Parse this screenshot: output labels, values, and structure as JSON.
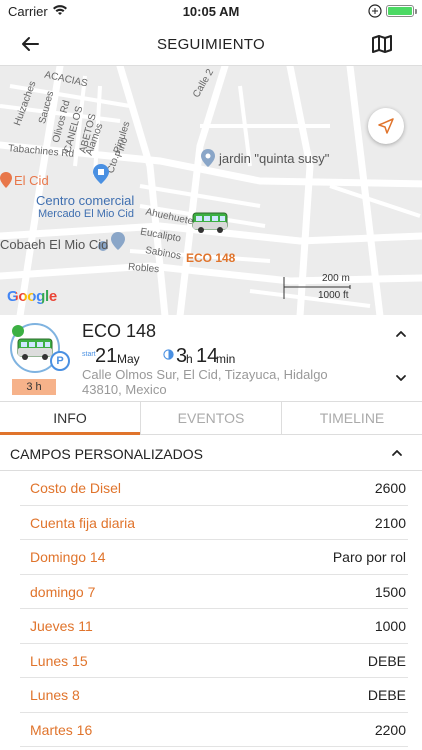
{
  "status_bar": {
    "carrier": "Carrier",
    "time": "10:05 AM"
  },
  "nav": {
    "title": "SEGUIMIENTO"
  },
  "map": {
    "street_labels": [
      "ACACIAS",
      "Huizaches",
      "Sauces",
      "Olivos Rd",
      "CANELOS",
      "ABETOS",
      "Alamos",
      "Cto. Pinules",
      "Pino",
      "Tabachines Rd",
      "Calle 2",
      "Ahuehuetes",
      "Eucalipto",
      "Sabinos",
      "Robles"
    ],
    "poi_jardin": "jardin \"quinta susy\"",
    "poi_elcid": "El Cid",
    "poi_centro_line1": "Centro comercial",
    "poi_centro_line2": "Mercado El Mio Cid",
    "poi_cobaeh": "Cobaeh El Mio Cid",
    "vehicle_label": "ECO 148",
    "google_logo": "Google",
    "scale_top": "200 m",
    "scale_bottom": "1000 ft"
  },
  "vehicle": {
    "name": "ECO 148",
    "start_label": "start",
    "start_day": "21",
    "start_month": "May",
    "duration_hours": "3",
    "duration_hours_unit": "h",
    "duration_minutes": "14",
    "duration_minutes_unit": "min",
    "address": "Calle Olmos Sur, El Cid, Tizayuca, Hidalgo 43810, Mexico",
    "hours_badge": "3 h",
    "parking_badge": "P"
  },
  "tabs": [
    {
      "label": "INFO",
      "active": true
    },
    {
      "label": "EVENTOS",
      "active": false
    },
    {
      "label": "TIMELINE",
      "active": false
    }
  ],
  "section": {
    "title": "CAMPOS PERSONALIZADOS"
  },
  "fields": [
    {
      "key": "Costo de Disel",
      "value": "2600"
    },
    {
      "key": "Cuenta fija diaria",
      "value": "2100"
    },
    {
      "key": "Domingo 14",
      "value": "Paro por rol"
    },
    {
      "key": "domingo 7",
      "value": "1500"
    },
    {
      "key": "Jueves 11",
      "value": "1000"
    },
    {
      "key": "Lunes 15",
      "value": "DEBE"
    },
    {
      "key": "Lunes 8",
      "value": "DEBE"
    },
    {
      "key": "Martes 16",
      "value": "2200"
    }
  ],
  "colors": {
    "accent": "#e0742c",
    "blue": "#4a90e2",
    "map_bg": "#ececec"
  }
}
